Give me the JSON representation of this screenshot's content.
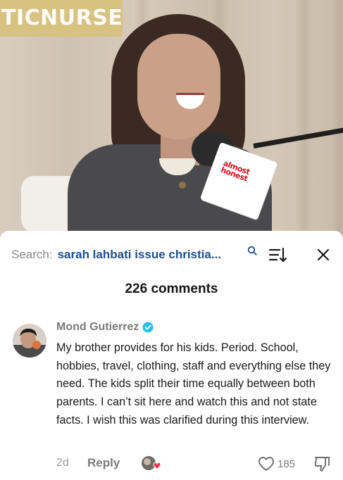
{
  "video": {
    "brand_overlay": "TICNURSE",
    "mic_cube_text": "almost honest"
  },
  "comments_panel": {
    "search_label": "Search:",
    "search_query": "sarah lahbati issue christia...",
    "icons": {
      "search": "search-icon",
      "sort": "sort-icon",
      "close": "close-icon"
    },
    "count_text": "226 comments"
  },
  "comment": {
    "username": "Mond Gutierrez",
    "verified": true,
    "verified_color": "#20c2e8",
    "text": "My brother provides for his kids. Period. School, hobbies, travel, clothing, staff and everything else they need. The kids split their time equally between both parents. I can’t sit here and watch this and not state facts. I wish this was clarified during this interview.",
    "timestamp": "2d",
    "reply_label": "Reply",
    "like_count": "185"
  },
  "colors": {
    "search_query": "#1f4e8c",
    "brand_badge": "#d8c27e",
    "heart_badge": "#ff2d55"
  }
}
